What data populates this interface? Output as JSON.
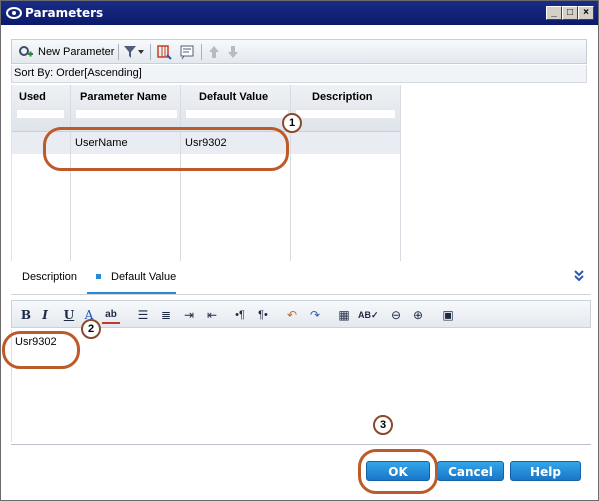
{
  "window": {
    "title": "Parameters"
  },
  "toolbar": {
    "new_parameter_label": "New Parameter"
  },
  "sort_by": "Sort By: Order[Ascending]",
  "grid": {
    "headers": [
      "Used",
      "Parameter Name",
      "Default Value",
      "Description"
    ],
    "rows": [
      {
        "used": "",
        "name": "UserName",
        "default_value": "Usr9302",
        "description": ""
      }
    ]
  },
  "tabs": [
    {
      "label": "Description"
    },
    {
      "label": "Default Value"
    }
  ],
  "editor": {
    "content": "Usr9302"
  },
  "buttons": {
    "ok": "OK",
    "cancel": "Cancel",
    "help": "Help"
  },
  "callouts": [
    "1",
    "2",
    "3"
  ],
  "colors": {
    "title_bar": "#0f1f75",
    "button_blue": "#2488d8",
    "callout_border": "#bd5a2a",
    "selected_row": "#e9edf3"
  }
}
